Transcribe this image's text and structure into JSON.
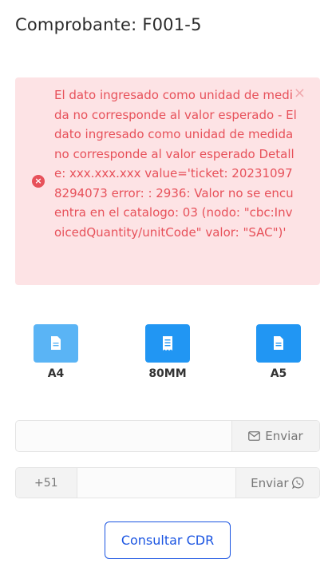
{
  "header": {
    "title": "Comprobante: F001-5"
  },
  "alert": {
    "message": "El dato ingresado como unidad de medida no corresponde al valor esperado - El dato ingresado como unidad de medida no corresponde al valor esperado Detalle: xxx.xxx.xxx value='ticket: 202310978294073 error: : 2936: Valor no se encuentra en el catalogo: 03 (nodo: \"cbc:InvoicedQuantity/unitCode\" valor: \"SAC\")'",
    "close_glyph": "×",
    "icon": "error-circle-icon",
    "color": "#e7515a",
    "background": "#fde3e5"
  },
  "formats": [
    {
      "label": "A4",
      "icon": "document-icon",
      "color": "#5ab4f5"
    },
    {
      "label": "80MM",
      "icon": "receipt-icon",
      "color": "#2196f3"
    },
    {
      "label": "A5",
      "icon": "document-icon",
      "color": "#2196f3"
    }
  ],
  "email": {
    "value": "",
    "placeholder": "",
    "send_label": "Enviar",
    "send_icon": "envelope-icon"
  },
  "whatsapp": {
    "prefix": "+51",
    "value": "",
    "placeholder": "",
    "send_label": "Enviar",
    "send_icon": "whatsapp-icon"
  },
  "cdr_button": {
    "label": "Consultar CDR",
    "color": "#1b55e2"
  }
}
